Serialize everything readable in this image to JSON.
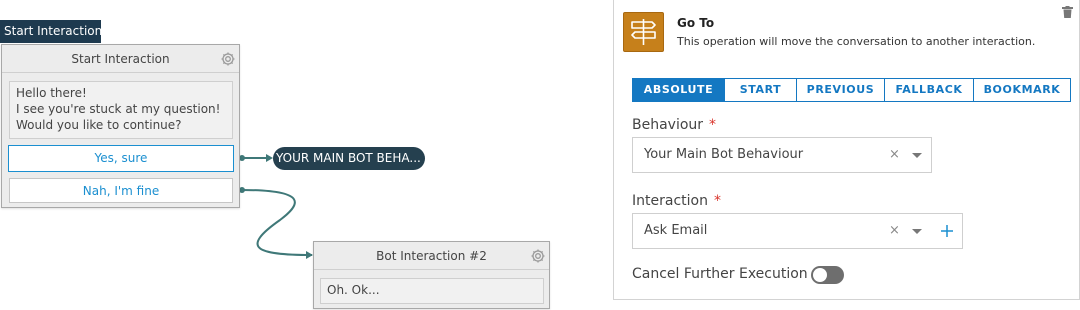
{
  "canvas": {
    "start_tag": "Start Interaction",
    "start_node": {
      "title": "Start Interaction",
      "message": [
        "Hello there!",
        "I see you're stuck at my question!",
        "Would you like to continue?"
      ],
      "choices": [
        "Yes, sure",
        "Nah, I'm fine"
      ]
    },
    "target_pill": "YOUR MAIN BOT BEHA...",
    "bot_node": {
      "title": "Bot Interaction #2",
      "message": "Oh. Ok..."
    }
  },
  "panel": {
    "title": "Go To",
    "description": "This operation will move the conversation to another interaction.",
    "tabs": [
      "ABSOLUTE",
      "START",
      "PREVIOUS",
      "FALLBACK",
      "BOOKMARK"
    ],
    "selected_tab": "ABSOLUTE",
    "behaviour": {
      "label": "Behaviour",
      "value": "Your Main Bot Behaviour"
    },
    "interaction": {
      "label": "Interaction",
      "value": "Ask Email"
    },
    "required_marker": "*",
    "clear_symbol": "×",
    "cancel_label": "Cancel Further Execution",
    "cancel_enabled": false
  },
  "colors": {
    "accent": "#1478c2",
    "link": "#1b8fd0",
    "connector": "#3f7878",
    "operation_icon": "#c6801b",
    "dark_pill": "#25404f",
    "required": "#d9342b"
  },
  "icons": [
    "gear-icon",
    "signpost-icon",
    "trash-icon",
    "chevron-down-icon",
    "plus-icon"
  ]
}
